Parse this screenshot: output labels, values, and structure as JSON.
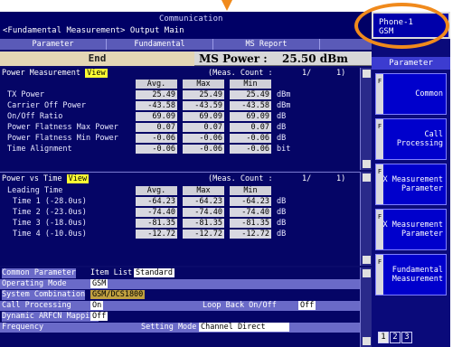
{
  "header": {
    "title": "Communication",
    "subtitle": "<Fundamental Measurement> Output Main"
  },
  "device": {
    "line1": "Phone-1",
    "line2": "GSM"
  },
  "tabs": [
    {
      "label": "Parameter"
    },
    {
      "label": "Fundamental"
    },
    {
      "label": "MS Report"
    }
  ],
  "status": {
    "state": "End",
    "ms_power_label": "MS Power :",
    "ms_power_value": "25.50 dBm"
  },
  "power_measurement": {
    "title": "Power Measurement",
    "view_label": "View",
    "count_label": "(Meas. Count :",
    "count_value": "1/",
    "count_total": "1)",
    "headers": [
      "Avg.",
      "Max",
      "Min"
    ],
    "rows": [
      {
        "label": "TX Power",
        "avg": "25.49",
        "max": "25.49",
        "min": "25.49",
        "unit": "dBm"
      },
      {
        "label": "Carrier Off Power",
        "avg": "-43.58",
        "max": "-43.59",
        "min": "-43.58",
        "unit": "dBm"
      },
      {
        "label": "On/Off Ratio",
        "avg": "69.09",
        "max": "69.09",
        "min": "69.09",
        "unit": "dB"
      },
      {
        "label": "Power Flatness Max Power",
        "avg": "0.07",
        "max": "0.07",
        "min": "0.07",
        "unit": "dB"
      },
      {
        "label": "Power Flatness Min Power",
        "avg": "-0.06",
        "max": "-0.06",
        "min": "-0.06",
        "unit": "dB"
      },
      {
        "label": "Time Alignment",
        "avg": "-0.06",
        "max": "-0.06",
        "min": "-0.06",
        "unit": "bit"
      }
    ]
  },
  "power_vs_time": {
    "title": "Power vs Time",
    "view_label": "View",
    "count_label": "(Meas. Count :",
    "count_value": "1/",
    "count_total": "1)",
    "leading_label": "Leading Time",
    "headers": [
      "Avg.",
      "Max",
      "Min"
    ],
    "rows": [
      {
        "label": "Time 1 (-28.0us)",
        "avg": "-64.23",
        "max": "-64.23",
        "min": "-64.23",
        "unit": "dB"
      },
      {
        "label": "Time 2 (-23.0us)",
        "avg": "-74.40",
        "max": "-74.40",
        "min": "-74.40",
        "unit": "dB"
      },
      {
        "label": "Time 3 (-18.0us)",
        "avg": "-81.35",
        "max": "-81.35",
        "min": "-81.35",
        "unit": "dB"
      },
      {
        "label": "Time 4 (-10.0us)",
        "avg": "-12.72",
        "max": "-12.72",
        "min": "-12.72",
        "unit": "dB"
      }
    ]
  },
  "common_parameter": {
    "title": "Common Parameter",
    "item_list_label": "Item List",
    "item_list_value": "Standard",
    "rows": [
      {
        "key": "Operating Mode",
        "value": "GSM"
      },
      {
        "key": "System Combination",
        "value": "GSM/DCS1800"
      },
      {
        "key": "Call Processing",
        "value": "On"
      },
      {
        "key": "Dynamic ARFCN Mapping",
        "value": "Off"
      },
      {
        "key": "Frequency",
        "value": ""
      }
    ],
    "loopback_label": "Loop Back On/Off",
    "loopback_value": "Off",
    "setting_mode_label": "Setting Mode",
    "setting_mode_value": "Channel Direct"
  },
  "sidebar": {
    "header": "Parameter",
    "buttons": [
      {
        "label": "Common"
      },
      {
        "label": "Call Processing"
      },
      {
        "label": "TX Measurement Parameter"
      },
      {
        "label": "RX Measurement Parameter"
      },
      {
        "label": "Fundamental Measurement"
      }
    ],
    "pages": [
      "1",
      "2",
      "3"
    ]
  },
  "colors": {
    "accent_orange": "#f08a1c",
    "screen_bg": "#0a0a6a",
    "view_badge": "#ffff33"
  }
}
